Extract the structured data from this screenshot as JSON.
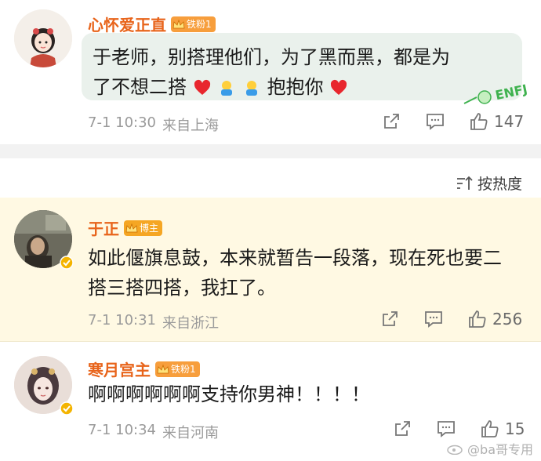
{
  "comments": [
    {
      "name": "心怀爱正直",
      "badge": "铁粉1",
      "text_line1": "于老师，别搭理他们，为了黑而黑，都是为",
      "text_line2": "了不想二搭",
      "text_line2_tail": "抱抱你",
      "time": "7-1 10:30",
      "location": "来自上海",
      "likes": "147"
    },
    {
      "name": "于正",
      "badge": "博主",
      "text": "如此偃旗息鼓，本来就暂告一段落，现在死也要二搭三搭四搭，我扛了。",
      "time": "7-1 10:31",
      "location": "来自浙江",
      "likes": "256"
    },
    {
      "name": "寒月宫主",
      "badge": "铁粉1",
      "text": "啊啊啊啊啊啊支持你男神！！！！",
      "time": "7-1 10:34",
      "location": "来自河南",
      "likes": "15"
    }
  ],
  "sort": {
    "label": "按热度"
  },
  "avatar1_caption": "心怀爱正直",
  "stamp_text": "ENFJ",
  "watermark": "@ba哥专用",
  "colors": {
    "name": "#e8641b",
    "bubble": "#eaf1ec",
    "highlight": "#fff9e3",
    "meta": "#9a9a9a"
  }
}
